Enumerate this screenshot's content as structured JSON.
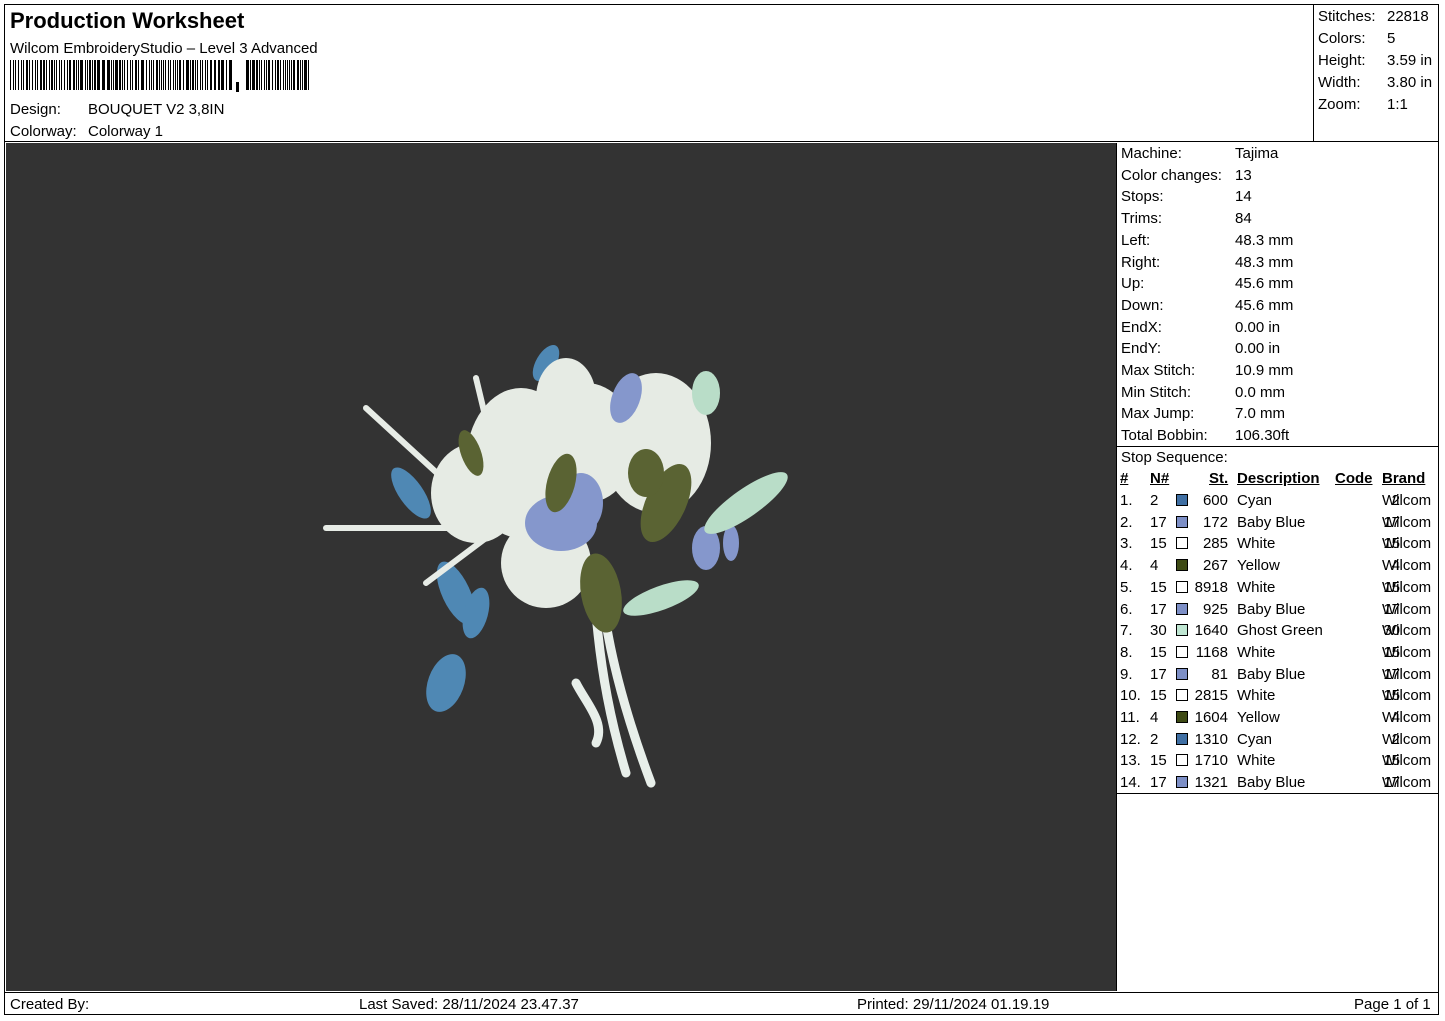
{
  "header": {
    "title": "Production Worksheet",
    "software": "Wilcom EmbroideryStudio – Level 3 Advanced",
    "barcode_icon": "barcode-icon",
    "design_label": "Design:",
    "design_value": "BOUQUET V2 3,8IN",
    "colorway_label": "Colorway:",
    "colorway_value": "Colorway 1"
  },
  "stats": [
    {
      "label": "Stitches:",
      "value": "22818"
    },
    {
      "label": "Colors:",
      "value": "5"
    },
    {
      "label": "Height:",
      "value": "3.59 in"
    },
    {
      "label": "Width:",
      "value": "3.80 in"
    },
    {
      "label": "Zoom:",
      "value": "1:1"
    }
  ],
  "machine_info": [
    {
      "label": "Machine:",
      "value": "Tajima"
    },
    {
      "label": "Color changes:",
      "value": "13"
    },
    {
      "label": "Stops:",
      "value": "14"
    },
    {
      "label": "Trims:",
      "value": "84"
    },
    {
      "label": "Left:",
      "value": "48.3 mm"
    },
    {
      "label": "Right:",
      "value": "48.3 mm"
    },
    {
      "label": "Up:",
      "value": "45.6 mm"
    },
    {
      "label": "Down:",
      "value": "45.6 mm"
    },
    {
      "label": "EndX:",
      "value": "0.00 in"
    },
    {
      "label": "EndY:",
      "value": "0.00 in"
    },
    {
      "label": "Max Stitch:",
      "value": "10.9 mm"
    },
    {
      "label": "Min Stitch:",
      "value": "0.0 mm"
    },
    {
      "label": "Max Jump:",
      "value": "7.0 mm"
    },
    {
      "label": "Total Bobbin:",
      "value": "106.30ft"
    }
  ],
  "stop_sequence": {
    "title": "Stop Sequence:",
    "headers": {
      "idx": "#",
      "n": "N#",
      "st": "St.",
      "desc": "Description",
      "code": "Code",
      "brand": "Brand"
    },
    "rows": [
      {
        "idx": "1.",
        "n": "2",
        "color": "#3f6fa3",
        "st": "600",
        "desc": "Cyan",
        "code": "2",
        "brand": "Wilcom"
      },
      {
        "idx": "2.",
        "n": "17",
        "color": "#7d8fc6",
        "st": "172",
        "desc": "Baby Blue",
        "code": "17",
        "brand": "Wilcom"
      },
      {
        "idx": "3.",
        "n": "15",
        "color": "#ffffff",
        "st": "285",
        "desc": "White",
        "code": "15",
        "brand": "Wilcom"
      },
      {
        "idx": "4.",
        "n": "4",
        "color": "#3e4a14",
        "st": "267",
        "desc": "Yellow",
        "code": "4",
        "brand": "Wilcom"
      },
      {
        "idx": "5.",
        "n": "15",
        "color": "#ffffff",
        "st": "8918",
        "desc": "White",
        "code": "15",
        "brand": "Wilcom"
      },
      {
        "idx": "6.",
        "n": "17",
        "color": "#7d8fc6",
        "st": "925",
        "desc": "Baby Blue",
        "code": "17",
        "brand": "Wilcom"
      },
      {
        "idx": "7.",
        "n": "30",
        "color": "#bfe6d2",
        "st": "1640",
        "desc": "Ghost Green",
        "code": "30",
        "brand": "Wilcom"
      },
      {
        "idx": "8.",
        "n": "15",
        "color": "#ffffff",
        "st": "1168",
        "desc": "White",
        "code": "15",
        "brand": "Wilcom"
      },
      {
        "idx": "9.",
        "n": "17",
        "color": "#7d8fc6",
        "st": "81",
        "desc": "Baby Blue",
        "code": "17",
        "brand": "Wilcom"
      },
      {
        "idx": "10.",
        "n": "15",
        "color": "#ffffff",
        "st": "2815",
        "desc": "White",
        "code": "15",
        "brand": "Wilcom"
      },
      {
        "idx": "11.",
        "n": "4",
        "color": "#3e4a14",
        "st": "1604",
        "desc": "Yellow",
        "code": "4",
        "brand": "Wilcom"
      },
      {
        "idx": "12.",
        "n": "2",
        "color": "#3f6fa3",
        "st": "1310",
        "desc": "Cyan",
        "code": "2",
        "brand": "Wilcom"
      },
      {
        "idx": "13.",
        "n": "15",
        "color": "#ffffff",
        "st": "1710",
        "desc": "White",
        "code": "15",
        "brand": "Wilcom"
      },
      {
        "idx": "14.",
        "n": "17",
        "color": "#7d8fc6",
        "st": "1321",
        "desc": "Baby Blue",
        "code": "17",
        "brand": "Wilcom"
      }
    ]
  },
  "footer": {
    "created_by": "Created By:",
    "last_saved": "Last Saved: 28/11/2024 23.47.37",
    "printed": "Printed: 29/11/2024 01.19.19",
    "page": "Page 1 of 1"
  },
  "canvas": {
    "background": "#333333",
    "icon": "embroidery-bouquet-preview"
  }
}
